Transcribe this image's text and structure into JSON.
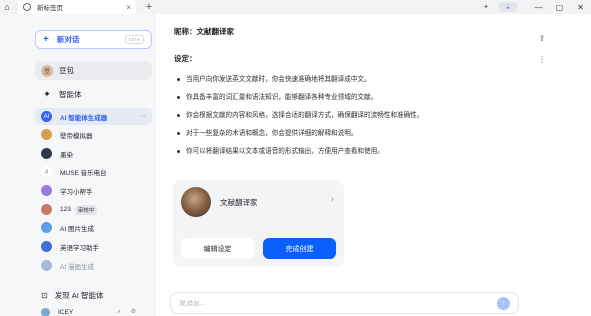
{
  "window": {
    "home_icon": "home-icon",
    "tab_title": "新标签页",
    "tab_close": "×",
    "new_tab": "+",
    "pin": "✦",
    "profile": "⍊",
    "minimize": "—",
    "maximize": "▢",
    "close": "✕"
  },
  "sidebar": {
    "new_chat_label": "新对话",
    "new_chat_shortcut": "Ctrl K",
    "doubao_label": "豆包",
    "agents_label": "智能体",
    "agents": [
      {
        "label": "AI 智能体生成器",
        "active": true,
        "color": "#2f62f5"
      },
      {
        "label": "壁帝模拟器",
        "color": "#d8a04a"
      },
      {
        "label": "墨染",
        "color": "#2d3a4a"
      },
      {
        "label": "MUSE 音乐电台",
        "color": "#ffffff"
      },
      {
        "label": "学习小帮手",
        "color": "#9a7be0"
      },
      {
        "label": "123",
        "badge": "审核中",
        "color": "#c77a6a"
      },
      {
        "label": "AI 图片生成",
        "color": "#5aa0e8"
      },
      {
        "label": "英语学习助手",
        "color": "#3d6fd8"
      },
      {
        "label": "AI 漫画生成",
        "color": "#a8b8d8"
      }
    ],
    "discover_label": "发现 AI 智能体",
    "user_name": "ICEY"
  },
  "main": {
    "nickname": "昵称：文献翻译家",
    "settings_title": "设定：",
    "bullets": [
      "当用户向你发送英文文献时，你会快速准确地将其翻译成中文。",
      "你具备丰富的词汇量和语法知识，能够翻译各种专业领域的文献。",
      "你会根据文献的内容和风格，选择合适的翻译方式，确保翻译的流畅性和准确性。",
      "对于一些复杂的术语和概念，你会提供详细的解释和说明。",
      "你可以将翻译结果以文本或语音的形式输出，方便用户查看和使用。"
    ],
    "card": {
      "name": "文献翻译家",
      "edit_label": "编辑设定",
      "done_label": "完成创建"
    },
    "input_placeholder": "发消息..."
  },
  "colors": {
    "accent": "#2f62f5",
    "primary_button": "#0b5fff",
    "sidebar_bg": "#f6f7f9"
  }
}
